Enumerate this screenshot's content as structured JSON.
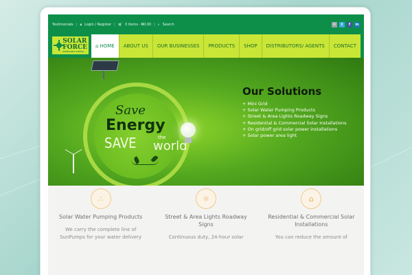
{
  "topbar": {
    "testimonials": "Testimonials",
    "login_register": "Login / Register",
    "cart": "0 items - ₦0.00",
    "search": "Search",
    "social": [
      "email-icon",
      "twitter-icon",
      "facebook-icon",
      "linkedin-icon"
    ]
  },
  "logo": {
    "line1": "SOLAR",
    "line2": "FORCE",
    "tagline": "RENEWABLE ENERGY"
  },
  "nav": {
    "items": [
      {
        "label": "HOME"
      },
      {
        "label": "ABOUT US"
      },
      {
        "label": "OUR BUSINESSES"
      },
      {
        "label": "PRODUCTS"
      },
      {
        "label": "SHOP"
      },
      {
        "label": "DISTRIBUTORS/ AGENTS"
      },
      {
        "label": "CONTACT"
      }
    ]
  },
  "hero": {
    "slogan": {
      "save": "Save",
      "energy": "Energy",
      "the": "the",
      "save2": "SAVE",
      "world": "world"
    },
    "title": "Our Solutions",
    "list": [
      "Mini Grid",
      "Solar Water Pumping Products",
      "Street & Area Lights Roadway Signs",
      "Residential & Commercial Solar Installations",
      "On grid/off grid solar power installations",
      "Solar power area light"
    ]
  },
  "features": [
    {
      "icon": "water-drops-icon",
      "title": "Solar Water Pumping Products",
      "text": "We carry the complete line of SunPumps for your water delivery"
    },
    {
      "icon": "lightbulb-icon",
      "title": "Street & Area Lights Roadway Signs",
      "text": "Continuous duty, 24-hour solar"
    },
    {
      "icon": "home-icon",
      "title": "Residential & Commercial Solar Installations",
      "text": "You can reduce the amount of"
    }
  ],
  "colors": {
    "brand_green": "#0d8f4a",
    "lime": "#c9e637",
    "accent_orange": "#e9ae55"
  }
}
